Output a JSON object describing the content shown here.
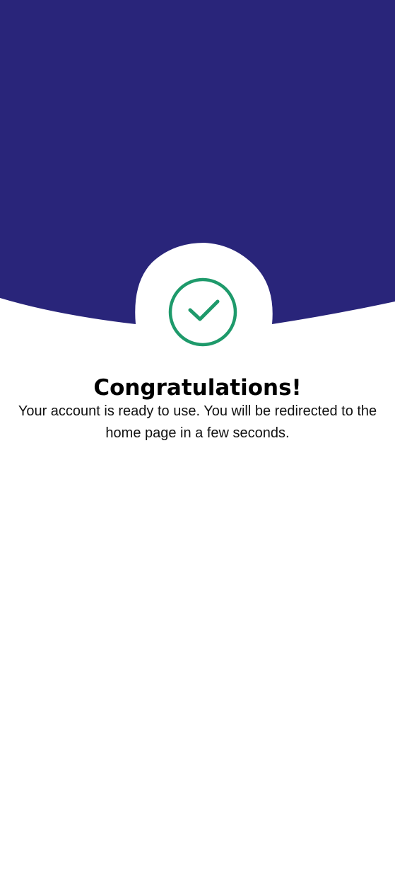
{
  "theme": {
    "header_color": "#29257A",
    "background_color": "#FFFFFF",
    "success_color": "#1E9A6B"
  },
  "success_screen": {
    "icon": "check-circle-icon",
    "title": "Congratulations!",
    "message": "Your account is ready to use. You will be redirected to the home page in a few seconds."
  }
}
